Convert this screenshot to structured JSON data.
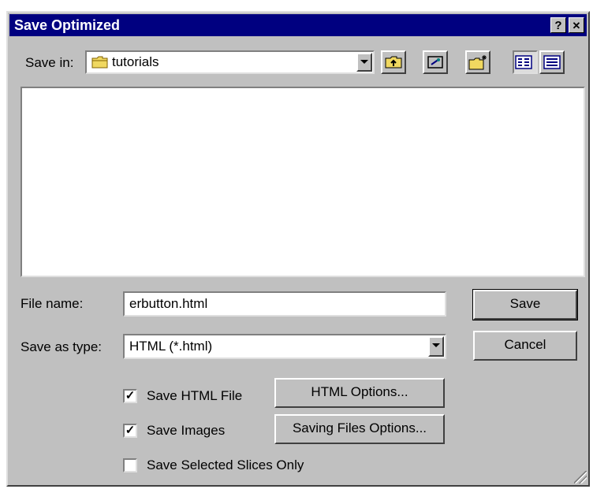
{
  "title": "Save Optimized",
  "title_buttons": {
    "help": "?",
    "close": "✕"
  },
  "save_in": {
    "label": "Save in:",
    "value": "tutorials"
  },
  "toolbar": {
    "up_folder_icon": "up-folder-icon",
    "desktop_icon": "desktop-icon",
    "new_folder_icon": "new-folder-icon",
    "list_view_icon": "list-view-icon",
    "details_view_icon": "details-view-icon"
  },
  "file_name": {
    "label": "File name:",
    "value": "erbutton.html"
  },
  "save_as_type": {
    "label": "Save as type:",
    "value": "HTML (*.html)"
  },
  "buttons": {
    "save": "Save",
    "cancel": "Cancel",
    "html_options": "HTML Options...",
    "saving_files_options": "Saving Files Options..."
  },
  "checkboxes": [
    {
      "label": "Save HTML File",
      "checked": true
    },
    {
      "label": "Save Images",
      "checked": true
    },
    {
      "label": "Save Selected Slices Only",
      "checked": false
    }
  ],
  "colors": {
    "title_bar": "#000080",
    "face": "#c0c0c0",
    "folder": "#f0d860"
  }
}
